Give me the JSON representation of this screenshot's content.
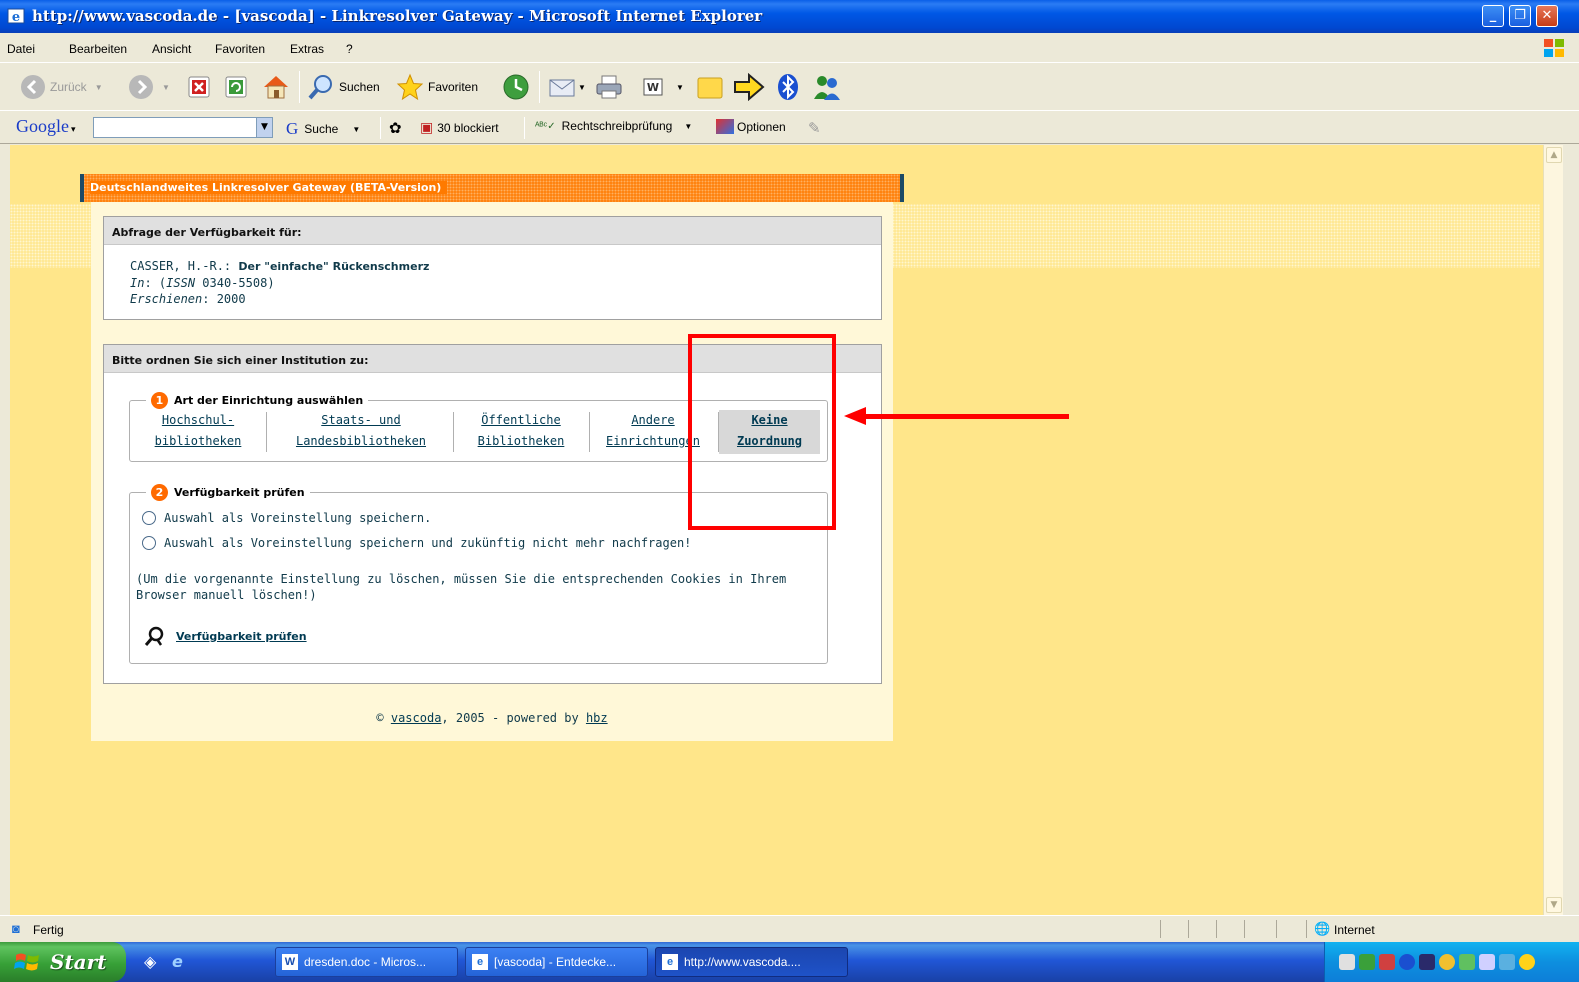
{
  "window": {
    "title": "http://www.vascoda.de - [vascoda] - Linkresolver Gateway - Microsoft Internet Explorer"
  },
  "menu": [
    "Datei",
    "Bearbeiten",
    "Ansicht",
    "Favoriten",
    "Extras",
    "?"
  ],
  "toolbar": {
    "back": "Zurück",
    "search": "Suchen",
    "favorites": "Favoriten"
  },
  "googlebar": {
    "logo": "Google",
    "search_value": "",
    "search_label": "Suche",
    "blocked": "30 blockiert",
    "spellcheck": "Rechtschreibprüfung",
    "options": "Optionen"
  },
  "page": {
    "header_title": "Deutschlandweites Linkresolver Gateway  (BETA-Version)",
    "availability_heading": "Abfrage der Verfügbarkeit für:",
    "record": {
      "author": "CASSER, H.-R.:",
      "title": "Der \"einfache\" Rückenschmerz",
      "in_label": "In",
      "issn_label": "ISSN",
      "issn_value": "0340-5508",
      "published_label": "Erschienen",
      "published_value": "2000"
    },
    "institution_heading": "Bitte ordnen Sie sich einer Institution zu:",
    "step1": {
      "number": "1",
      "label": "Art der Einrichtung auswählen",
      "tabs": [
        {
          "line1": "Hochschul-",
          "line2": "bibliotheken"
        },
        {
          "line1": "Staats- und",
          "line2": "Landesbibliotheken"
        },
        {
          "line1": "Öffentliche",
          "line2": "Bibliotheken"
        },
        {
          "line1": "Andere",
          "line2": "Einrichtungen"
        },
        {
          "line1": "Keine",
          "line2": "Zuordnung"
        }
      ]
    },
    "step2": {
      "number": "2",
      "label": "Verfügbarkeit prüfen",
      "radio1": "Auswahl als Voreinstellung speichern.",
      "radio2": "Auswahl als Voreinstellung speichern und zukünftig nicht mehr nachfragen!",
      "note_line1": "(Um die vorgenannte Einstellung zu löschen, müssen Sie die entsprechenden Cookies in Ihrem",
      "note_line2": "Browser manuell löschen!)",
      "check_link": "Verfügbarkeit prüfen"
    },
    "footer": {
      "copyright": "©",
      "vascoda": "vascoda",
      "middle": ", 2005 - powered by",
      "hbz": "hbz"
    }
  },
  "status": {
    "text": "Fertig",
    "zone": "Internet"
  },
  "taskbar": {
    "start": "Start",
    "tasks": [
      "dresden.doc - Micros...",
      "[vascoda] - Entdecke...",
      "http://www.vascoda...."
    ]
  },
  "colors": {
    "header_orange": "#ff7a00",
    "page_bg": "#ffe68a",
    "annotation_red": "#ff0000",
    "link_teal": "#003a52"
  }
}
